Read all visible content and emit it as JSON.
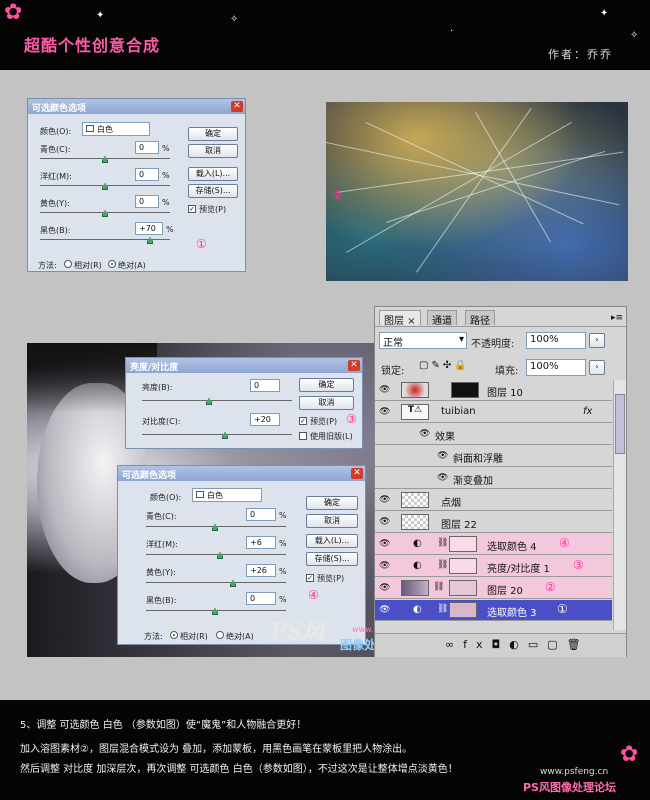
{
  "header": {
    "title": "超酷个性创意合成",
    "author": "作者：乔乔"
  },
  "dialog1": {
    "title": "可选颜色选项",
    "colors_label": "颜色(O):",
    "colors_value": "白色",
    "sliders": [
      {
        "label": "青色(C):",
        "value": "0"
      },
      {
        "label": "洋红(M):",
        "value": "0"
      },
      {
        "label": "黄色(Y):",
        "value": "0"
      },
      {
        "label": "黑色(B):",
        "value": "+70"
      }
    ],
    "unit": "%",
    "ok": "确定",
    "cancel": "取消",
    "load": "载入(L)...",
    "save": "存储(S)...",
    "preview": "预览(P)",
    "method_label": "方法:",
    "relative": "相对(R)",
    "absolute": "绝对(A)",
    "marker": "①"
  },
  "art_marker": "②",
  "brightness": {
    "title": "亮度/对比度",
    "brightness_label": "亮度(B):",
    "brightness_value": "0",
    "contrast_label": "对比度(C):",
    "contrast_value": "+20",
    "ok": "确定",
    "cancel": "取消",
    "preview": "预览(P)",
    "legacy": "使用旧版(L)",
    "marker": "③"
  },
  "dialog2": {
    "title": "可选颜色选项",
    "colors_label": "颜色(O):",
    "colors_value": "白色",
    "sliders": [
      {
        "label": "青色(C):",
        "value": "0"
      },
      {
        "label": "洋红(M):",
        "value": "+6"
      },
      {
        "label": "黄色(Y):",
        "value": "+26"
      },
      {
        "label": "黑色(B):",
        "value": "0"
      }
    ],
    "unit": "%",
    "ok": "确定",
    "cancel": "取消",
    "load": "载入(L)...",
    "save": "存储(S)...",
    "preview": "预览(P)",
    "method_label": "方法:",
    "relative": "相对(R)",
    "absolute": "绝对(A)",
    "marker": "④"
  },
  "watermark": {
    "url": "www.psfeng.cn",
    "text": "图像处理论坛",
    "logo": "PS风"
  },
  "layers": {
    "tabs": [
      "图层",
      "通道",
      "路径"
    ],
    "blend": "正常",
    "opacity_label": "不透明度:",
    "opacity": "100%",
    "lock_label": "锁定:",
    "fill_label": "填充:",
    "fill": "100%",
    "rows": [
      {
        "name": "图层 10",
        "marker": "",
        "style": "normal"
      },
      {
        "name": "tuibian",
        "marker": "",
        "style": "normal"
      },
      {
        "name": "效果",
        "marker": "",
        "style": "effect"
      },
      {
        "name": "斜面和浮雕",
        "marker": "",
        "style": "subeffect"
      },
      {
        "name": "渐变叠加",
        "marker": "",
        "style": "subeffect"
      },
      {
        "name": "点烟",
        "marker": "",
        "style": "normal"
      },
      {
        "name": "图层 22",
        "marker": "",
        "style": "normal"
      },
      {
        "name": "选取颜色 4",
        "marker": "④",
        "style": "pink"
      },
      {
        "name": "亮度/对比度 1",
        "marker": "③",
        "style": "pink"
      },
      {
        "name": "图层 20",
        "marker": "②",
        "style": "pink"
      },
      {
        "name": "选取颜色 3",
        "marker": "①",
        "style": "sel"
      }
    ]
  },
  "footer": {
    "line1": "5、调整 可选颜色 白色 （参数如图）使“魔鬼”和人物融合更好！",
    "line2": "加入溶图素材②，图层混合模式设为 叠加，添加蒙板，用黑色画笔在蒙板里把人物涂出。",
    "line3": "然后调整 对比度 加深层次，再次调整 可选颜色 白色（参数如图），不过这次是让整体增点淡黄色！",
    "site": "www.psfeng.cn",
    "forum": "PS风图像处理论坛"
  }
}
